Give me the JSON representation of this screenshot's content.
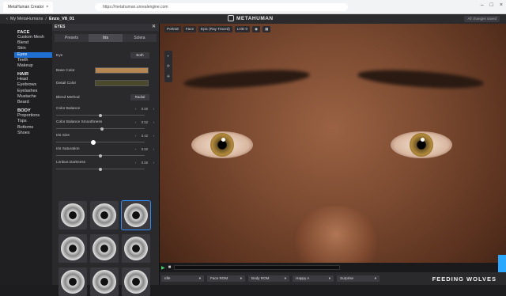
{
  "browser": {
    "tab_title": "MetaHuman Creator",
    "url": "https://metahuman.unrealengine.com"
  },
  "header": {
    "crumb_home": "My MetaHumans",
    "crumb_current": "Enzo_V8_01",
    "logo_text": "METAHUMAN",
    "saved_status": "All changes saved"
  },
  "nav": {
    "groups": [
      {
        "title": "FACE",
        "items": [
          "Custom Mesh",
          "Blend",
          "Skin",
          "Eyes",
          "Teeth",
          "Makeup"
        ]
      },
      {
        "title": "HAIR",
        "items": [
          "Head",
          "Eyebrows",
          "Eyelashes",
          "Mustache",
          "Beard"
        ]
      },
      {
        "title": "BODY",
        "items": [
          "Proportions",
          "Tops",
          "Bottoms",
          "Shoes"
        ]
      }
    ],
    "active_item": "Eyes"
  },
  "panel": {
    "title": "EYES",
    "tabs": [
      "Presets",
      "Iris",
      "Sclera"
    ],
    "active_tab": "Iris",
    "eye_label": "Eye",
    "eye_value": "Both",
    "base_color_label": "Base Color",
    "base_color_hex": "#b48755",
    "detail_color_label": "Detail Color",
    "detail_color_hex": "#4b4a2c",
    "blend_method_label": "Blend Method",
    "blend_method_value": "Radial",
    "sliders": [
      {
        "label": "Color Balance",
        "value": "0.50",
        "fraction": 0.5
      },
      {
        "label": "Color Balance Smoothness",
        "value": "0.52",
        "fraction": 0.52
      },
      {
        "label": "Iris Size",
        "value": "0.42",
        "fraction": 0.42
      },
      {
        "label": "Iris Saturation",
        "value": "0.50",
        "fraction": 0.5
      },
      {
        "label": "Limbus Darkness",
        "value": "0.50",
        "fraction": 0.5
      }
    ],
    "presets_selected_index": 2
  },
  "viewport": {
    "toolbar": [
      "Portrait",
      "Face",
      "Epic (Ray Traced)",
      "LOD 0"
    ],
    "animations": [
      "Idle",
      "Face ROM",
      "Body ROM",
      "Happy A",
      "Surprise"
    ]
  },
  "watermark": "FEEDING WOLVES"
}
